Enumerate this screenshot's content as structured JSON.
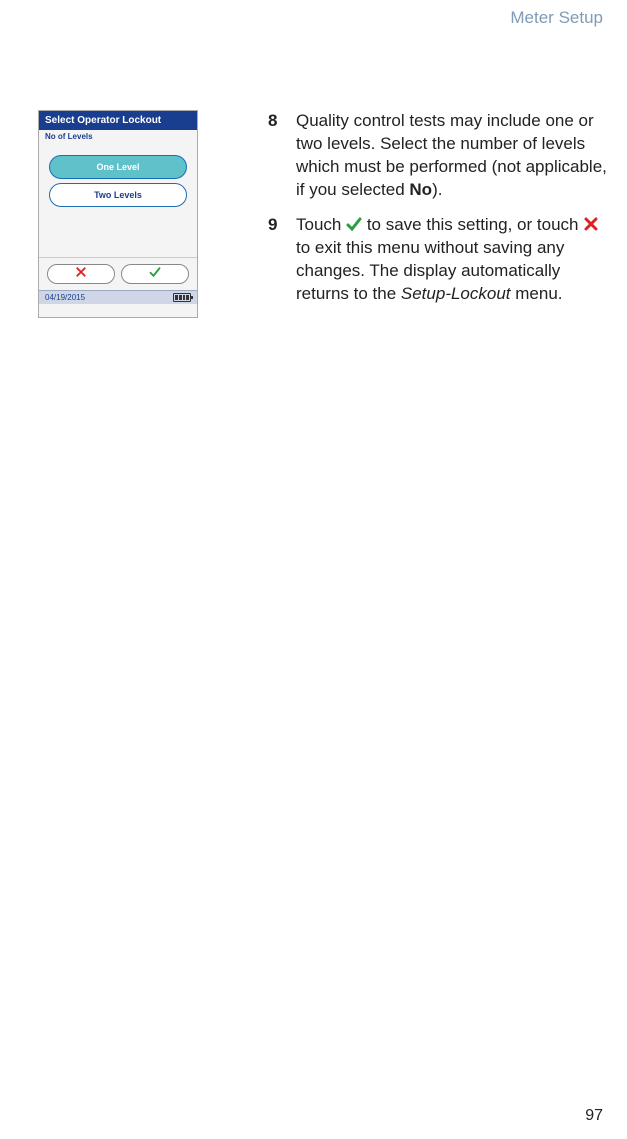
{
  "header": {
    "section": "Meter Setup"
  },
  "footer": {
    "page": "97"
  },
  "device": {
    "title": "Select Operator Lockout",
    "sublabel": "No of Levels",
    "options": {
      "one": "One Level",
      "two": "Two Levels"
    },
    "date": "04/19/2015"
  },
  "steps": {
    "s8": {
      "num": "8",
      "text_a": "Quality control tests may include one or two levels. Select the number of levels which must be performed (not applicable, if you selected ",
      "bold": "No",
      "text_b": ")."
    },
    "s9": {
      "num": "9",
      "text_a": "Touch ",
      "text_b": " to save this setting, or touch ",
      "text_c": " to exit this menu without saving any changes. The display automatically returns to the ",
      "italic": "Setup-Lockout",
      "text_d": " menu."
    }
  }
}
